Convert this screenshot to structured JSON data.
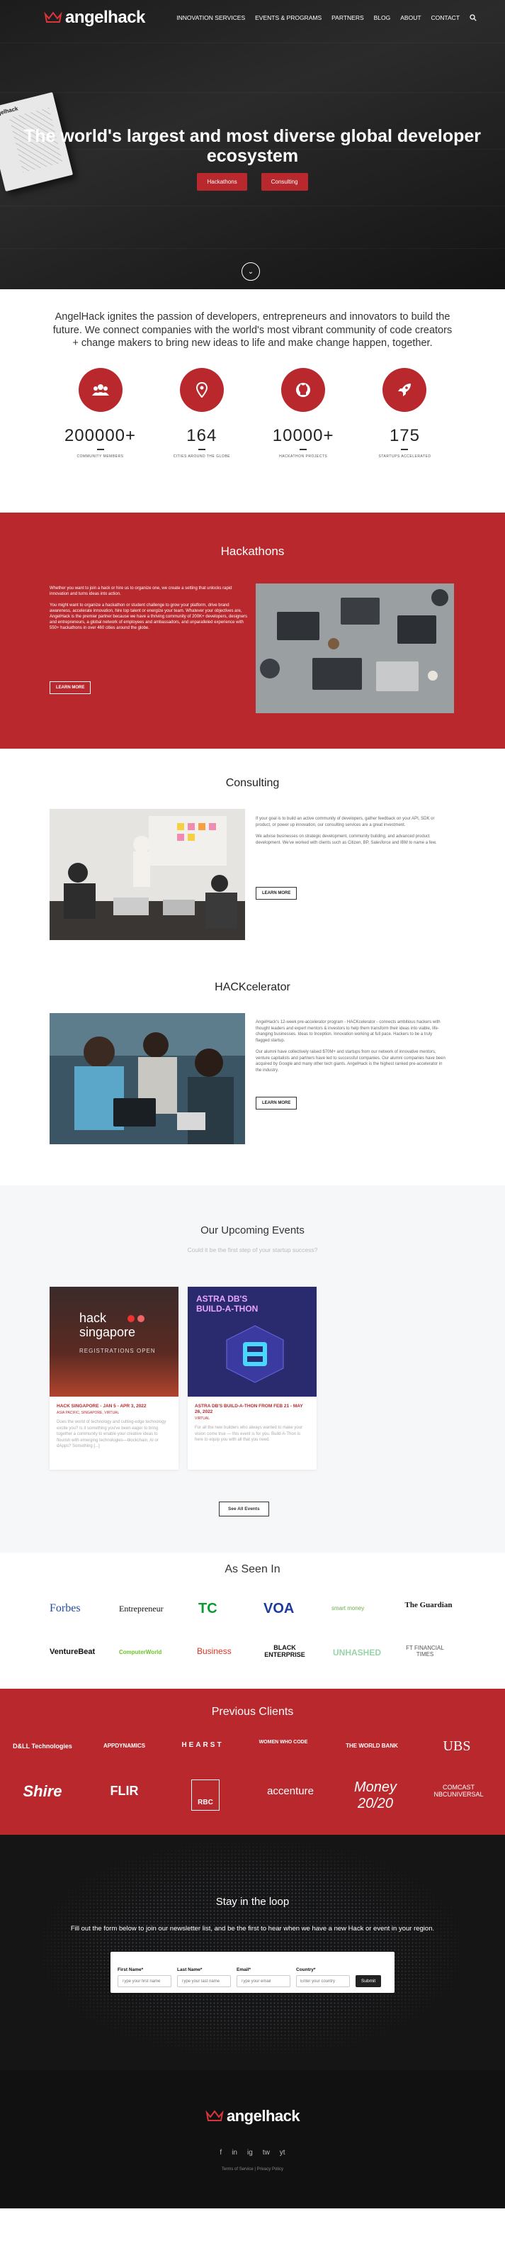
{
  "nav": {
    "brand": "angelhack",
    "items": [
      "INNOVATION SERVICES",
      "EVENTS & PROGRAMS",
      "PARTNERS",
      "BLOG",
      "ABOUT",
      "CONTACT"
    ]
  },
  "hero": {
    "book_title": "angelhack",
    "title": "The world's largest and most diverse global developer ecosystem",
    "btn_hackathons": "Hackathons",
    "btn_consulting": "Consulting"
  },
  "intro": {
    "text": "AngelHack ignites the passion of developers, entrepreneurs and innovators to build the future. We connect companies with the world's most vibrant community of code creators + change makers to bring new ideas to life and make change happen, together."
  },
  "stats": [
    {
      "num": "200000+",
      "label": "COMMUNITY MEMBERS",
      "icon": "users-icon"
    },
    {
      "num": "164",
      "label": "CITIES AROUND THE GLOBE",
      "icon": "map-pin-icon"
    },
    {
      "num": "10000+",
      "label": "HACKATHON PROJECTS",
      "icon": "github-icon"
    },
    {
      "num": "175",
      "label": "STARTUPS ACCELERATED",
      "icon": "rocket-icon"
    }
  ],
  "hackathons": {
    "title": "Hackathons",
    "p1": "Whether you want to join a hack or hire us to organize one, we create a setting that unlocks rapid innovation and turns ideas into action.",
    "p2": "You might want to organize a hackathon or student challenge to grow your platform, drive brand awareness, accelerate innovation, hire top talent or energize your team. Whatever your objectives are, AngelHack is the premier partner because we have a thriving community of 200K+ developers, designers and entrepreneurs, a global network of employees and ambassadors, and unparalleled experience with 550+ hackathons in over 460 cities around the globe.",
    "button": "LEARN MORE"
  },
  "consulting": {
    "title": "Consulting",
    "p1": "If your goal is to build an active community of developers, gather feedback on your API, SDK or product, or power up innovation, our consulting services are a great investment.",
    "p2": "We advise businesses on strategic development, community building, and advanced product development. We've worked with clients such as Citizen, BP, Salesforce and IBM to name a few.",
    "button": "LEARN MORE"
  },
  "hackcelerator": {
    "title": "HACKcelerator",
    "p1": "AngelHack's 12-week pre-accelerator program - HACKcelerator - connects ambitious hackers with thought leaders and expert mentors & investors to help them transform their ideas into viable, life-changing businesses. Ideas to Inception. Innovation working at full pace. Hackers to be a truly flagged startup.",
    "p2": "Our alumni have collectively raised $70M+ and startups from our network of innovative mentors, venture capitalists and partners have led to successful companies. Our alumni companies have been acquired by Google and many other tech giants. AngelHack is the highest ranked pre-accelerator in the industry.",
    "button": "LEARN MORE"
  },
  "events": {
    "title": "Our Upcoming Events",
    "subtitle": "Could it be the first step of your startup success?",
    "cards": [
      {
        "img_line1": "hack",
        "img_line2": "singapore",
        "img_line3": "REGISTRATIONS OPEN",
        "title": "HACK SINGAPORE - JAN 5 - APR 3, 2022",
        "location": "ASIA PACIFIC, SINGAPORE, VIRTUAL",
        "desc": "Does the world of technology and cutting-edge technology excite you? Is it something you've been eager to bring together a community to enable your creative ideas to flourish with emerging technologies—blockchain, AI or dApps? Something [...]"
      },
      {
        "img_line1": "ASTRA DB'S",
        "img_line2": "BUILD-A-THON",
        "img_line3": "",
        "title": "ASTRA DB'S BUILD-A-THON FROM FEB 21 - MAY 26, 2022",
        "location": "VIRTUAL",
        "desc": "For all the new builders who always wanted to make your vision come true — this event is for you. Build-A-Thon is here to equip you with all that you need."
      }
    ],
    "button": "See All Events"
  },
  "press": {
    "title": "As Seen In",
    "logos": [
      "Forbes",
      "Entrepreneur",
      "TC",
      "VOA",
      "smart money",
      "The Guardian",
      "VentureBeat",
      "ComputerWorld",
      "Business",
      "BLACK ENTERPRISE",
      "UNHASHED",
      "FT FINANCIAL TIMES"
    ]
  },
  "clients": {
    "title": "Previous Clients",
    "logos": [
      "D&LL Technologies",
      "APPDYNAMICS",
      "HEARST",
      "WOMEN WHO CODE",
      "THE WORLD BANK",
      "UBS",
      "Shire",
      "FLIR",
      "RBC",
      "accenture",
      "Money 20/20",
      "COMCAST NBCUNIVERSAL"
    ]
  },
  "newsletter": {
    "title": "Stay in the loop",
    "subtitle": "Fill out the form below to join our newsletter list, and be the first to hear when we have a new Hack or event in your region.",
    "fields": [
      {
        "label": "First Name*",
        "placeholder": "Type your first name"
      },
      {
        "label": "Last Name*",
        "placeholder": "Type your last name"
      },
      {
        "label": "Email*",
        "placeholder": "Type your email"
      },
      {
        "label": "Country*",
        "placeholder": "Enter your country"
      }
    ],
    "submit": "Submit"
  },
  "footer": {
    "brand": "angelhack",
    "social": [
      "f",
      "in",
      "ig",
      "tw",
      "yt"
    ],
    "legal": "Terms of Service | Privacy Policy"
  },
  "colors": {
    "brand_red": "#b8282d",
    "dark": "#151515"
  }
}
